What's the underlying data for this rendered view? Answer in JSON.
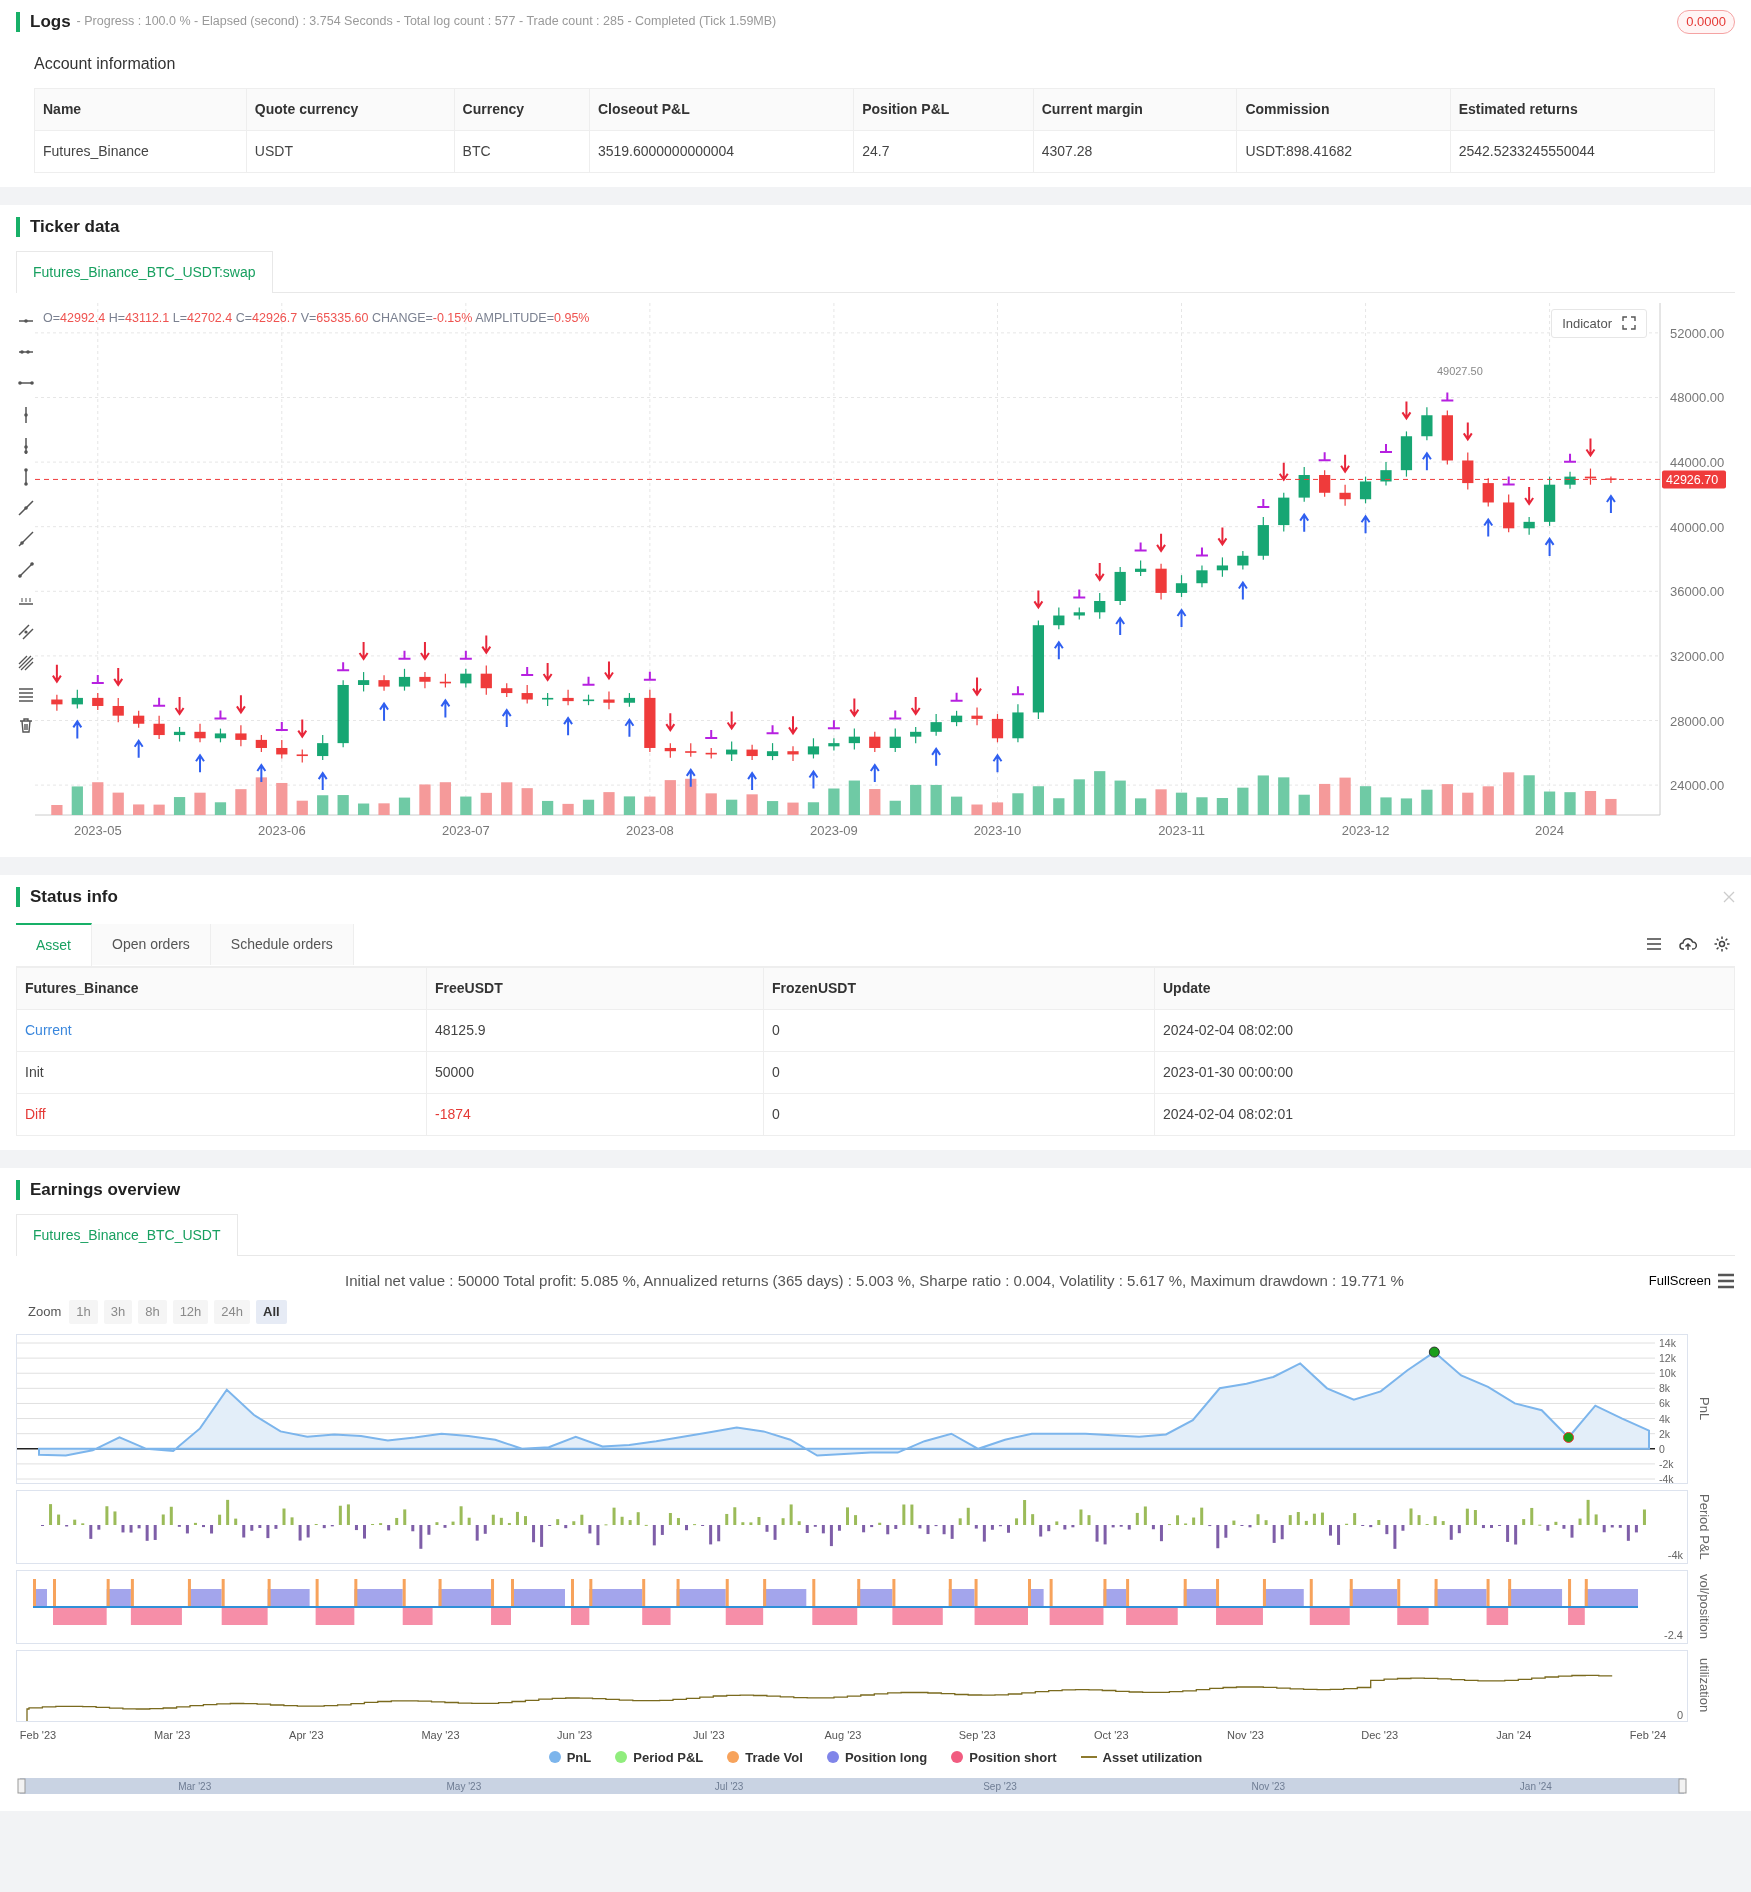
{
  "logs": {
    "title": "Logs",
    "progress": "- Progress : 100.0 % - Elapsed (second) : 3.754  Seconds - Total log count : 577 - Trade count : 285 - Completed (Tick 1.59MB)",
    "badge": "0.0000"
  },
  "account": {
    "title": "Account information",
    "columns": [
      "Name",
      "Quote currency",
      "Currency",
      "Closeout P&L",
      "Position P&L",
      "Current margin",
      "Commission",
      "Estimated returns"
    ],
    "rows": [
      [
        "Futures_Binance",
        "USDT",
        "BTC",
        "3519.6000000000004",
        "24.7",
        "4307.28",
        "USDT:898.41682",
        "2542.5233245550044"
      ]
    ]
  },
  "ticker": {
    "title": "Ticker data",
    "tabs": [
      {
        "label": "Futures_Binance_BTC_USDT:swap",
        "selected": true
      }
    ],
    "ohlc_info": [
      {
        "label": "O=",
        "value": "42992.4"
      },
      {
        "label": "H=",
        "value": "43112.1"
      },
      {
        "label": "L=",
        "value": "42702.4"
      },
      {
        "label": "C=",
        "value": "42926.7"
      },
      {
        "label": "V=",
        "value": "65335.60"
      },
      {
        "label": "CHANGE=",
        "value": "-0.15%"
      },
      {
        "label": "AMPLITUDE=",
        "value": "0.95%"
      }
    ],
    "indicator_button": "Indicator",
    "high_marker": "49027.50",
    "chart_data": {
      "type": "candlestick",
      "grid": true,
      "ylim": [
        22150,
        53850
      ],
      "ref_lines": [
        {
          "axis": "y",
          "value": 42926.7,
          "label": "42926.70",
          "color": "#ef3b3b"
        }
      ],
      "categories": [
        null,
        null,
        "2023-05",
        null,
        null,
        null,
        null,
        null,
        null,
        null,
        null,
        "2023-06",
        null,
        null,
        null,
        null,
        null,
        null,
        null,
        null,
        "2023-07",
        null,
        null,
        null,
        null,
        null,
        null,
        null,
        null,
        "2023-08",
        null,
        null,
        null,
        null,
        null,
        null,
        null,
        null,
        "2023-09",
        null,
        null,
        null,
        null,
        null,
        null,
        null,
        "2023-10",
        null,
        null,
        null,
        null,
        null,
        null,
        null,
        null,
        "2023-11",
        null,
        null,
        null,
        null,
        null,
        null,
        null,
        null,
        "2023-12",
        null,
        null,
        null,
        null,
        null,
        null,
        null,
        null,
        "2024",
        null,
        null,
        null
      ],
      "ohlc": [
        [
          29300,
          29600,
          28600,
          29000
        ],
        [
          29000,
          29900,
          28750,
          29400
        ],
        [
          29400,
          29700,
          28650,
          28900
        ],
        [
          28900,
          29400,
          27900,
          28300
        ],
        [
          28300,
          28600,
          27550,
          27800
        ],
        [
          27800,
          28300,
          26850,
          27100
        ],
        [
          27100,
          27600,
          26700,
          27300
        ],
        [
          27300,
          27800,
          26650,
          26900
        ],
        [
          26900,
          27500,
          26650,
          27200
        ],
        [
          27200,
          27700,
          26400,
          26800
        ],
        [
          26800,
          27100,
          26050,
          26300
        ],
        [
          26300,
          26800,
          25650,
          25900
        ],
        [
          25900,
          26200,
          25400,
          25800
        ],
        [
          25800,
          27100,
          25550,
          26600
        ],
        [
          26600,
          30500,
          26350,
          30200
        ],
        [
          30200,
          31000,
          29800,
          30500
        ],
        [
          30500,
          30800,
          29850,
          30100
        ],
        [
          30100,
          31200,
          29850,
          30700
        ],
        [
          30700,
          31000,
          30000,
          30400
        ],
        [
          30400,
          30900,
          30050,
          30300
        ],
        [
          30300,
          31200,
          30050,
          30900
        ],
        [
          30900,
          31400,
          29600,
          30000
        ],
        [
          30000,
          30300,
          29450,
          29700
        ],
        [
          29700,
          30200,
          29050,
          29300
        ],
        [
          29300,
          29700,
          28900,
          29400
        ],
        [
          29400,
          29900,
          28950,
          29200
        ],
        [
          29200,
          29600,
          28950,
          29300
        ],
        [
          29300,
          29800,
          28700,
          29100
        ],
        [
          29100,
          29700,
          28850,
          29400
        ],
        [
          29400,
          29900,
          26050,
          26300
        ],
        [
          26300,
          26600,
          25700,
          26100
        ],
        [
          26100,
          26600,
          25750,
          26000
        ],
        [
          26000,
          26300,
          25650,
          25900
        ],
        [
          25900,
          26700,
          25500,
          26200
        ],
        [
          26200,
          26500,
          25550,
          25800
        ],
        [
          25800,
          26600,
          25550,
          26100
        ],
        [
          26100,
          26400,
          25500,
          25900
        ],
        [
          25900,
          26900,
          25650,
          26400
        ],
        [
          26400,
          26900,
          26150,
          26600
        ],
        [
          26600,
          27500,
          26200,
          27000
        ],
        [
          27000,
          27300,
          26050,
          26300
        ],
        [
          26300,
          27500,
          26050,
          27000
        ],
        [
          27000,
          27600,
          26600,
          27300
        ],
        [
          27300,
          28400,
          27050,
          27900
        ],
        [
          27900,
          28600,
          27650,
          28300
        ],
        [
          28300,
          28800,
          27700,
          28100
        ],
        [
          28100,
          28400,
          26650,
          26900
        ],
        [
          26900,
          29000,
          26650,
          28500
        ],
        [
          28500,
          34200,
          28100,
          33900
        ],
        [
          33900,
          35000,
          33650,
          34500
        ],
        [
          34500,
          35000,
          34250,
          34700
        ],
        [
          34700,
          35900,
          34300,
          35400
        ],
        [
          35400,
          37500,
          35150,
          37200
        ],
        [
          37200,
          37900,
          36950,
          37400
        ],
        [
          37400,
          37700,
          35500,
          35900
        ],
        [
          35900,
          37000,
          35650,
          36500
        ],
        [
          36500,
          37600,
          36250,
          37300
        ],
        [
          37300,
          38100,
          36900,
          37600
        ],
        [
          37600,
          38500,
          37350,
          38200
        ],
        [
          38200,
          40600,
          37950,
          40100
        ],
        [
          40100,
          42100,
          39700,
          41800
        ],
        [
          41800,
          43700,
          41550,
          43200
        ],
        [
          43200,
          43500,
          41850,
          42100
        ],
        [
          42100,
          42600,
          41300,
          41700
        ],
        [
          41700,
          43100,
          41450,
          42800
        ],
        [
          42800,
          44000,
          42550,
          43500
        ],
        [
          43500,
          45900,
          43100,
          45600
        ],
        [
          45600,
          47400,
          45350,
          46900
        ],
        [
          46900,
          47200,
          43850,
          44100
        ],
        [
          44100,
          44600,
          42300,
          42700
        ],
        [
          42700,
          43000,
          41250,
          41500
        ],
        [
          41500,
          42000,
          39650,
          39900
        ],
        [
          39900,
          40600,
          39500,
          40300
        ],
        [
          40300,
          43100,
          40050,
          42600
        ],
        [
          42600,
          43400,
          42350,
          43100
        ],
        [
          43100,
          43600,
          42600,
          42992.4
        ],
        [
          42992.4,
          43112.1,
          42702.4,
          42926.7
        ]
      ],
      "yticks": [
        {
          "value": 52000,
          "label": "52000.00"
        },
        {
          "value": 48000,
          "label": "48000.00"
        },
        {
          "value": 44000,
          "label": "44000.00"
        },
        {
          "value": 40000,
          "label": "40000.00"
        },
        {
          "value": 36000,
          "label": "36000.00"
        },
        {
          "value": 32000,
          "label": "32000.00"
        },
        {
          "value": 28000,
          "label": "28000.00"
        },
        {
          "value": 24000,
          "label": "24000.00"
        }
      ]
    }
  },
  "status": {
    "title": "Status info",
    "tabs": [
      {
        "label": "Asset",
        "selected": true
      },
      {
        "label": "Open orders",
        "selected": false
      },
      {
        "label": "Schedule orders",
        "selected": false
      }
    ],
    "columns": [
      "Futures_Binance",
      "FreeUSDT",
      "FrozenUSDT",
      "Update"
    ],
    "rows": [
      {
        "kind": "link",
        "cells": [
          "Current",
          "48125.9",
          "0",
          "2024-02-04 08:02:00"
        ]
      },
      {
        "kind": "plain",
        "cells": [
          "Init",
          "50000",
          "0",
          "2023-01-30 00:00:00"
        ]
      },
      {
        "kind": "negative",
        "cells": [
          "Diff",
          "-1874",
          "0",
          "2024-02-04 08:02:01"
        ]
      }
    ]
  },
  "earnings": {
    "title": "Earnings overview",
    "tabs": [
      {
        "label": "Futures_Binance_BTC_USDT",
        "selected": true
      }
    ],
    "summary": "Initial net value : 50000 Total profit: 5.085 %, Annualized returns (365 days) : 5.003 %, Sharpe ratio : 0.004, Volatility : 5.617 %, Maximum drawdown : 19.771 %",
    "fullscreen": "FullScreen",
    "zoom_label": "Zoom",
    "zoom_buttons": [
      {
        "label": "1h",
        "selected": false,
        "disabled": true
      },
      {
        "label": "3h",
        "selected": false,
        "disabled": true
      },
      {
        "label": "8h",
        "selected": false,
        "disabled": true
      },
      {
        "label": "12h",
        "selected": false,
        "disabled": true
      },
      {
        "label": "24h",
        "selected": false,
        "disabled": true
      },
      {
        "label": "All",
        "selected": true,
        "disabled": false
      }
    ],
    "pnl": {
      "chart_data": {
        "type": "area",
        "grid": true,
        "ylabel": "PnL",
        "ylim": [
          -4000,
          14000
        ],
        "series": [
          {
            "name": "PnL",
            "color": "#7cb5ec",
            "values": [
              -800,
              -900,
              -200,
              1500,
              0,
              -300,
              2700,
              7800,
              4500,
              2300,
              1600,
              1900,
              1700,
              1100,
              1500,
              2000,
              1700,
              1200,
              0,
              200,
              1600,
              300,
              500,
              1000,
              1600,
              2200,
              2800,
              2300,
              1200,
              -900,
              -700,
              -500,
              -500,
              1000,
              2000,
              0,
              1200,
              2000,
              2000,
              2000,
              1800,
              1600,
              1900,
              3800,
              8000,
              8600,
              9500,
              11300,
              8000,
              6500,
              7600,
              10400,
              12800,
              9700,
              8200,
              6000,
              5100,
              1500,
              5700,
              4000,
              2400
            ]
          }
        ],
        "yticks": [
          {
            "value": 14000,
            "label": "14k"
          },
          {
            "value": 12000,
            "label": "12k"
          },
          {
            "value": 10000,
            "label": "10k"
          },
          {
            "value": 8000,
            "label": "8k"
          },
          {
            "value": 6000,
            "label": "6k"
          },
          {
            "value": 4000,
            "label": "4k"
          },
          {
            "value": 2000,
            "label": "2k"
          },
          {
            "value": 0,
            "label": "0"
          },
          {
            "value": -2000,
            "label": "-2k"
          },
          {
            "value": -4000,
            "label": "-4k"
          }
        ]
      }
    },
    "time_axis": [
      "Feb '23",
      "Mar '23",
      "Apr '23",
      "May '23",
      "Jun '23",
      "Jul '23",
      "Aug '23",
      "Sep '23",
      "Oct '23",
      "Nov '23",
      "Dec '23",
      "Jan '24",
      "Feb '24"
    ],
    "period_pnl": {
      "axis_title": "Period P&L",
      "tick": "-4k"
    },
    "position": {
      "axis_title": "vol/position",
      "tick": "-2.4"
    },
    "utilization": {
      "axis_title": "utilization",
      "tick": "0"
    },
    "legend": [
      {
        "color": "#7cb5ec",
        "kind": "dot"
      },
      {
        "label": "Period P&L",
        "color": "#90ed7d",
        "kind": "dot"
      },
      {
        "label": "Trade Vol",
        "color": "#f7a35c",
        "kind": "dot"
      },
      {
        "label": "Position long",
        "color": "#8085e9",
        "kind": "dot"
      },
      {
        "label": "Position short",
        "color": "#f15c80",
        "kind": "dot"
      },
      {
        "label": "Asset utilization",
        "color": "#8d7a2e",
        "kind": "line"
      }
    ],
    "navigator_ticks": [
      "Mar '23",
      "May '23",
      "Jul '23",
      "Sep '23",
      "Nov '23",
      "Jan '24"
    ]
  }
}
